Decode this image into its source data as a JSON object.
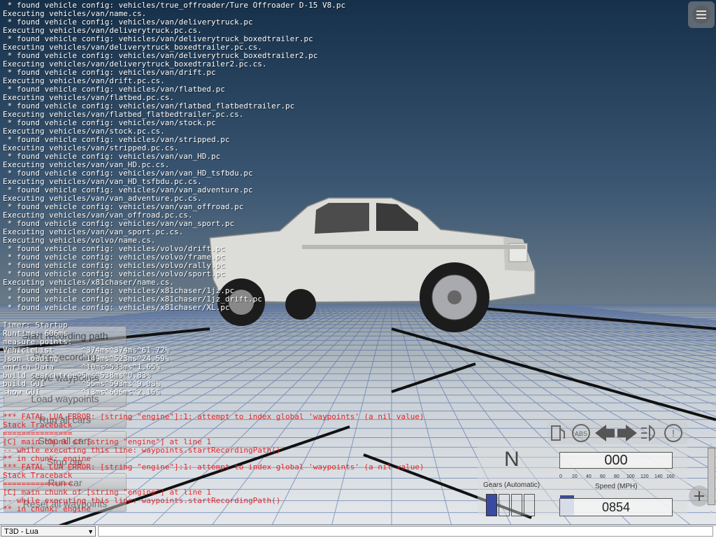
{
  "console": {
    "lines": [
      " * found vehicle config: vehicles/true_offroader/Ture Offroader D-15 V8.pc",
      "Executing vehicles/van/name.cs.",
      " * found vehicle config: vehicles/van/deliverytruck.pc",
      "Executing vehicles/van/deliverytruck.pc.cs.",
      " * found vehicle config: vehicles/van/deliverytruck_boxedtrailer.pc",
      "Executing vehicles/van/deliverytruck_boxedtrailer.pc.cs.",
      " * found vehicle config: vehicles/van/deliverytruck_boxedtrailer2.pc",
      "Executing vehicles/van/deliverytruck_boxedtrailer2.pc.cs.",
      " * found vehicle config: vehicles/van/drift.pc",
      "Executing vehicles/van/drift.pc.cs.",
      " * found vehicle config: vehicles/van/flatbed.pc",
      "Executing vehicles/van/flatbed.pc.cs.",
      " * found vehicle config: vehicles/van/flatbed_flatbedtrailer.pc",
      "Executing vehicles/van/flatbed_flatbedtrailer.pc.cs.",
      " * found vehicle config: vehicles/van/stock.pc",
      "Executing vehicles/van/stock.pc.cs.",
      " * found vehicle config: vehicles/van/stripped.pc",
      "Executing vehicles/van/stripped.pc.cs.",
      " * found vehicle config: vehicles/van/van_HD.pc",
      "Executing vehicles/van/van_HD.pc.cs.",
      " * found vehicle config: vehicles/van/van_HD_tsfbdu.pc",
      "Executing vehicles/van/van_HD_tsfbdu.pc.cs.",
      " * found vehicle config: vehicles/van/van_adventure.pc",
      "Executing vehicles/van/van_adventure.pc.cs.",
      " * found vehicle config: vehicles/van/van_offroad.pc",
      "Executing vehicles/van/van_offroad.pc.cs.",
      " * found vehicle config: vehicles/van/van_sport.pc",
      "Executing vehicles/van/van_sport.pc.cs.",
      "Executing vehicles/volvo/name.cs.",
      " * found vehicle config: vehicles/volvo/drift.pc",
      " * found vehicle config: vehicles/volvo/frame.pc",
      " * found vehicle config: vehicles/volvo/rally.pc",
      " * found vehicle config: vehicles/volvo/sport.pc",
      "Executing vehicles/x81chaser/name.cs.",
      " * found vehicle config: vehicles/x81chaser/1jz.pc",
      " * found vehicle config: vehicles/x81chaser/1jz_drift.pc",
      " * found vehicle config: vehicles/x81chaser/XL.pc"
    ],
    "timer_lines": [
      "Timer: Startup",
      "Runtime: 606ms",
      "measure points:",
      "VehicleList      ^374ms^374ms^61.72%",
      "json loading     ^149ms^523ms^24.59%",
      "enrich Data      ^10ms^533ms^1.65%",
      "build searchtree^5ms^538ms^0.83%",
      "build GUI        ^55ms^593ms^9.08%",
      "show GUI         ^13ms^606ms^2.15%"
    ],
    "error_lines": [
      {
        "text": "*** FATAL LUA ERROR: [string \"engine\"]:1: attempt to index global 'waypoints' (a nil value)",
        "indent": false
      },
      {
        "text": "Stack Traceback",
        "indent": false
      },
      {
        "text": "===============",
        "indent": false
      },
      {
        "text": "[C] main chunk of [string \"engine\"] at line 1",
        "indent": false
      },
      {
        "text": "-- while executing this line: waypoints.startRecordingPath()",
        "indent": false
      },
      {
        "text": "** in chunk: engine",
        "indent": false
      },
      {
        "text": "*** FATAL LUA ERROR: [string \"engine\"]:1: attempt to index global 'waypoints' (a nil value)",
        "indent": false
      },
      {
        "text": "Stack Traceback",
        "indent": false
      },
      {
        "text": "===============",
        "indent": false
      },
      {
        "text": "[C] main chunk of [string \"engine\"] at line 1",
        "indent": false
      },
      {
        "text": "-- while executing this line: waypoints.startRecordingPath()",
        "indent": false
      },
      {
        "text": "** in chunk: engine",
        "indent": false
      }
    ]
  },
  "waypoint_buttons": [
    {
      "label": "Start recording path",
      "name": "start-recording-path-button"
    },
    {
      "label": "Stop recording",
      "name": "stop-recording-button"
    },
    {
      "label": "Save waypoints",
      "name": "save-waypoints-button"
    },
    {
      "label": "Load waypoints",
      "name": "load-waypoints-button"
    },
    {
      "label": "Run all cars",
      "name": "run-all-cars-button"
    },
    {
      "label": "Stop all cars",
      "name": "stop-all-cars-button"
    },
    {
      "label": "Stop car",
      "name": "stop-car-button"
    },
    {
      "label": "Run car",
      "name": "run-car-button"
    },
    {
      "label": "Reset all waypoints",
      "name": "reset-all-waypoints-button"
    }
  ],
  "hud": {
    "gear": "N",
    "gears_label": "Gears (Automatic)",
    "speed": "000",
    "speed_label": "Speed (MPH)",
    "speed_ticks": [
      "0",
      "20",
      "40",
      "60",
      "80",
      "100",
      "120",
      "140",
      "160"
    ],
    "odometer": "0854",
    "icons": [
      "fuel-icon",
      "abs-icon",
      "left-signal-icon",
      "right-signal-icon",
      "headlight-icon",
      "brake-warning-icon"
    ]
  },
  "bottom_bar": {
    "context": "T3D - Lua",
    "command_value": ""
  },
  "colors": {
    "console_text": "#ffffff",
    "error_text": "#e4161a",
    "sky_top": "#1f3a56",
    "sky_bottom": "#5a6e80",
    "ground": "#d8dde2",
    "grid_line": "#3a5a9a"
  }
}
